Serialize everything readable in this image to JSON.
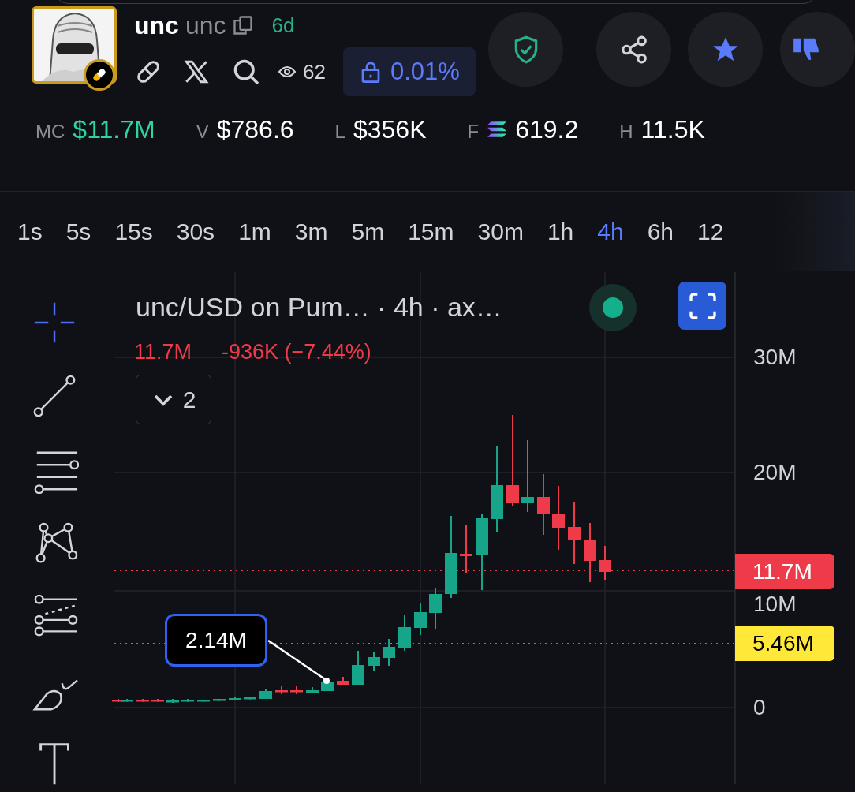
{
  "token": {
    "name": "unc",
    "ticker": "unc",
    "age": "6d",
    "views": "62",
    "lock": "0.01%"
  },
  "actions": [
    {
      "kind": "shield"
    },
    {
      "kind": "share"
    },
    {
      "kind": "star"
    },
    {
      "kind": "dislike"
    }
  ],
  "stats": [
    {
      "label": "MC",
      "value": "$11.7M",
      "highlight": true,
      "kind": "plain"
    },
    {
      "label": "V",
      "value": "$786.6",
      "highlight": false,
      "kind": "plain"
    },
    {
      "label": "L",
      "value": "$356K",
      "highlight": false,
      "kind": "plain"
    },
    {
      "label": "F",
      "value": "619.2",
      "highlight": false,
      "kind": "sol"
    },
    {
      "label": "H",
      "value": "11.5K",
      "highlight": false,
      "kind": "plain"
    }
  ],
  "timeframes": [
    {
      "label": "1s",
      "selected": false
    },
    {
      "label": "5s",
      "selected": false
    },
    {
      "label": "15s",
      "selected": false
    },
    {
      "label": "30s",
      "selected": false
    },
    {
      "label": "1m",
      "selected": false
    },
    {
      "label": "3m",
      "selected": false
    },
    {
      "label": "5m",
      "selected": false
    },
    {
      "label": "15m",
      "selected": false
    },
    {
      "label": "30m",
      "selected": false
    },
    {
      "label": "1h",
      "selected": false
    },
    {
      "label": "4h",
      "selected": true
    },
    {
      "label": "6h",
      "selected": false
    },
    {
      "label": "12",
      "selected": false
    }
  ],
  "tools": [
    {
      "kind": "crosshair",
      "selected": true
    },
    {
      "kind": "trend_line",
      "selected": false
    },
    {
      "kind": "horizontal_lines",
      "selected": false
    },
    {
      "kind": "pattern",
      "selected": false
    },
    {
      "kind": "fib",
      "selected": false
    },
    {
      "kind": "brush",
      "selected": false
    },
    {
      "kind": "text",
      "selected": false
    }
  ],
  "chart": {
    "title": "unc/USD on Pum… · 4h · ax…",
    "price": "11.7M",
    "change": "-936K (−7.44%)",
    "indicators": "2",
    "y_ticks": [
      "30M",
      "20M",
      "10M",
      "0"
    ],
    "last_price": "11.7M",
    "marker": "5.46M",
    "annotation": "2.14M"
  }
}
